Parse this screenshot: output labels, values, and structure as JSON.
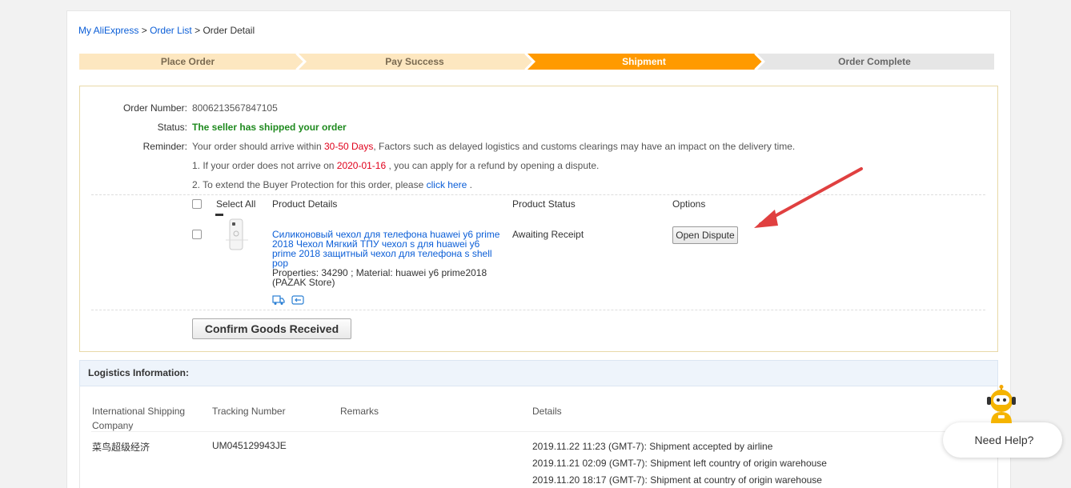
{
  "breadcrumb": {
    "home": "My AliExpress",
    "list": "Order List",
    "current": "Order Detail",
    "sep": ">"
  },
  "steps": [
    {
      "label": "Place Order",
      "state": "done"
    },
    {
      "label": "Pay Success",
      "state": "done"
    },
    {
      "label": "Shipment",
      "state": "current"
    },
    {
      "label": "Order Complete",
      "state": "pending"
    }
  ],
  "colors": {
    "step_done": "#fde7c0",
    "step_current": "#ff9a00",
    "step_pending": "#e6e6e6",
    "accent_red": "#e0001b",
    "link": "#0b5ed7",
    "status_green": "#1f8a1f",
    "arrow": "#e04040"
  },
  "order": {
    "number_label": "Order Number:",
    "number": "8006213567847105",
    "status_label": "Status:",
    "status": "The seller has shipped your order",
    "reminder_label": "Reminder:",
    "reminder_pre": "Your order should arrive within ",
    "reminder_days": "30-50 Days",
    "reminder_post": ", Factors such as delayed logistics and customs clearings may have an impact on the delivery time.",
    "note1_pre": "1. If your order does not arrive on ",
    "note1_date": "2020-01-16",
    "note1_post": " , you can apply for a refund by opening a dispute.",
    "note2_pre": "2. To extend the Buyer Protection for this order, please ",
    "note2_link": "click here",
    "note2_post": " ."
  },
  "table": {
    "select_all": "Select All",
    "col_details": "Product Details",
    "col_status": "Product Status",
    "col_options": "Options"
  },
  "product": {
    "title": "Силиконовый чехол для телефона huawei y6 prime 2018 Чехол Мягкий ТПУ чехол s для huawei y6 prime 2018 защитный чехол для телефона s shell pop",
    "properties": "Properties: 34290   ; Material: huawei y6 prime2018",
    "store": "(PAZAK Store)",
    "status": "Awaiting Receipt",
    "dispute_button": "Open Dispute",
    "icons": [
      "truck-icon",
      "card-icon"
    ]
  },
  "confirm_button": "Confirm Goods Received",
  "logistics": {
    "title": "Logistics Information:",
    "headers": {
      "company": "International Shipping Company",
      "tracking": "Tracking Number",
      "remarks": "Remarks",
      "details": "Details"
    },
    "company": "菜鸟超级经济",
    "tracking": "UM045129943JE",
    "events": [
      "2019.11.22 11:23 (GMT-7): Shipment accepted by airline",
      "2019.11.21 02:09 (GMT-7): Shipment left country of origin warehouse",
      "2019.11.20 18:17 (GMT-7): Shipment at country of origin warehouse"
    ]
  },
  "help": {
    "label": "Need Help?",
    "icon": "robot-mascot-icon"
  }
}
